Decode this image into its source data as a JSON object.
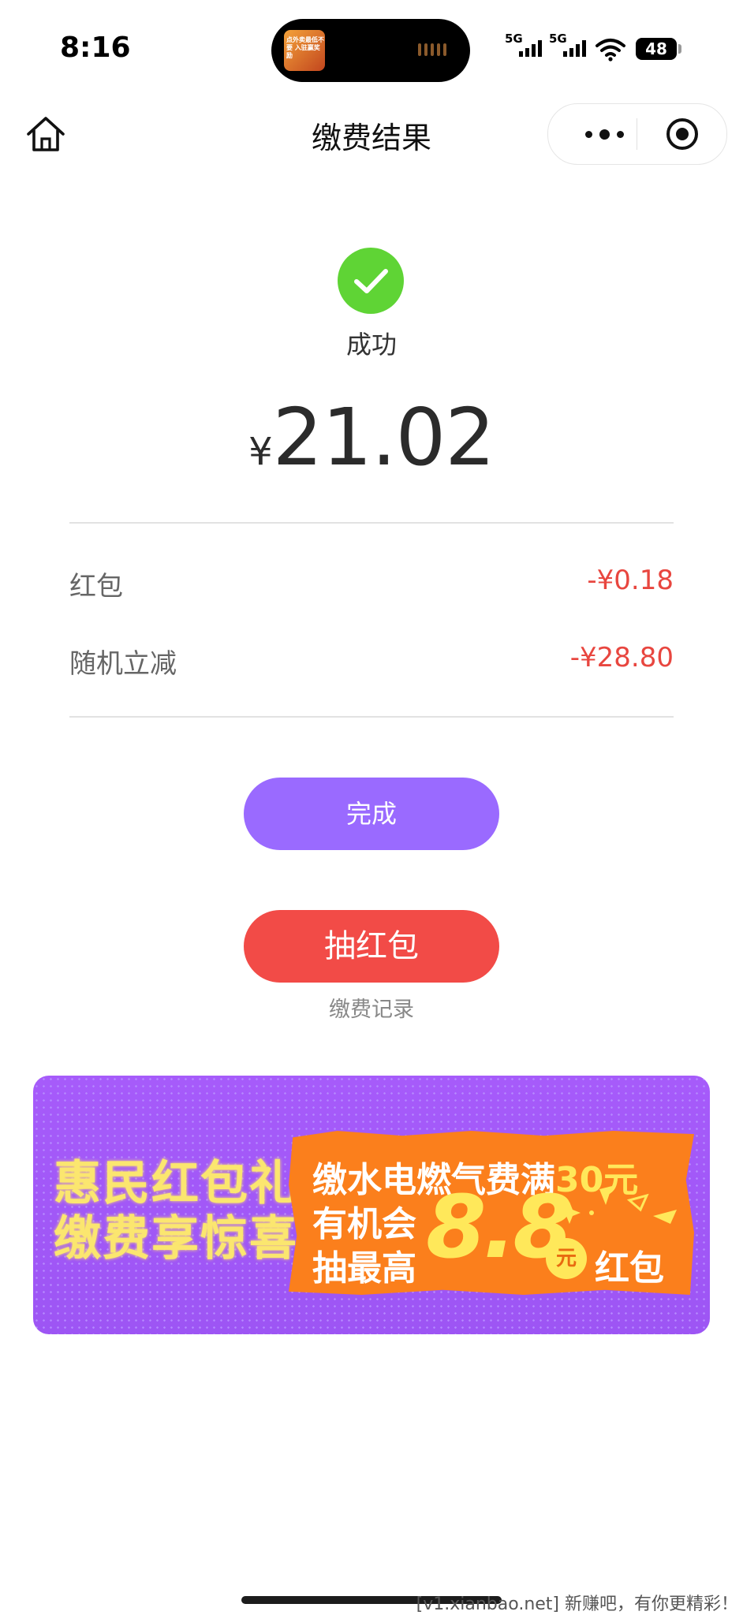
{
  "status_bar": {
    "time": "8:16",
    "network_1": "5G",
    "network_2": "5G",
    "battery": "48"
  },
  "island": {
    "thumb_text": "点外卖最低不要 入驻赢奖励"
  },
  "nav": {
    "title": "缴费结果"
  },
  "result": {
    "status": "成功",
    "currency_symbol": "¥",
    "amount": "21.02",
    "color": "#5fd435"
  },
  "deductions": [
    {
      "label": "红包",
      "value": "-¥0.18"
    },
    {
      "label": "随机立减",
      "value": "-¥28.80"
    }
  ],
  "buttons": {
    "done": "完成",
    "lottery": "抽红包",
    "record": "缴费记录"
  },
  "banner": {
    "left_line1": "惠民红包礼",
    "left_line2": "缴费享惊喜",
    "right_line1": "缴水电燃气费满",
    "right_line1_highlight": "30元",
    "right_line2": "有机会",
    "right_line3": "抽最高",
    "big_amount": "8.8",
    "unit": "元",
    "suffix": "红包"
  },
  "watermark": "[v1.xianbao.net] 新赚吧，有你更精彩！",
  "colors": {
    "primary_purple": "#9a6aff",
    "lottery_red": "#f24b47",
    "deduction_red": "#e8463f",
    "banner_purple": "#a65bfa",
    "banner_orange": "#fb7f1c"
  }
}
